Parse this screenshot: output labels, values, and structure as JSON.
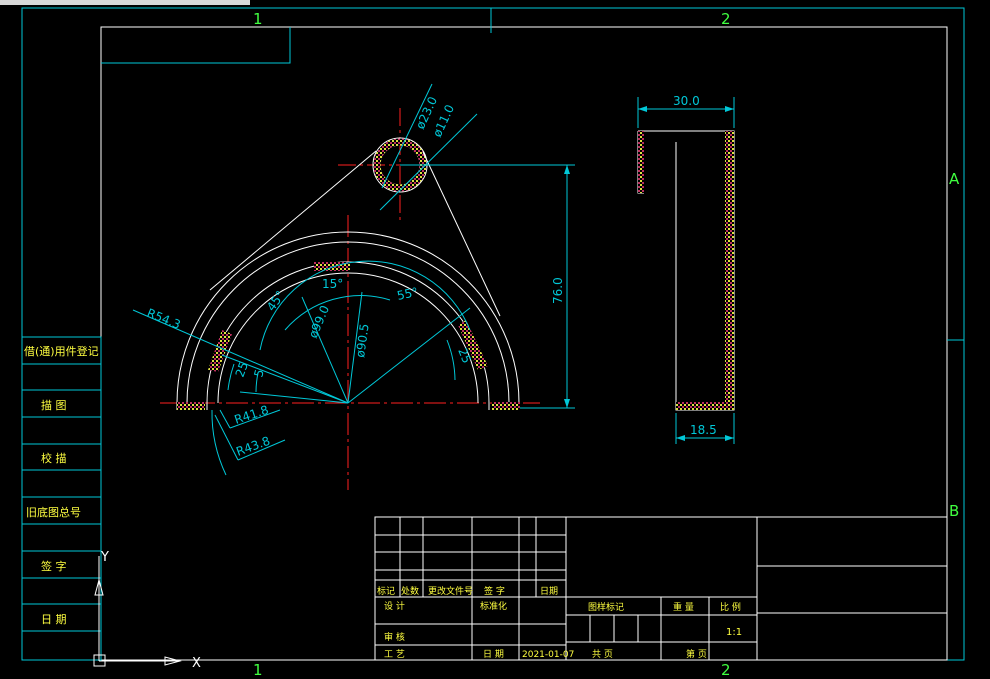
{
  "zone_marks": {
    "top_1": "1",
    "top_2": "2",
    "bottom_1": "1",
    "bottom_2": "2",
    "right_a": "A",
    "right_b": "B"
  },
  "left_strip": {
    "items": [
      "借(通)用件登记",
      "描  图",
      "校  描",
      "旧底图总号",
      "签  字",
      "日  期"
    ]
  },
  "dimensions": {
    "d23": "ø23.0",
    "d11": "ø11.0",
    "r54": "R54.3",
    "d99": "ø99.0",
    "d90": "ø90.5",
    "a45": "45°",
    "a15": "15°",
    "a55": "55°",
    "a25_left": "25",
    "a25_right": "25",
    "a5": "5",
    "r41": "R41.8",
    "r43": "R43.8",
    "h76": "76.0",
    "w30": "30.0",
    "w18": "18.5"
  },
  "title_block": {
    "row_labels": [
      "标记",
      "处数",
      "更改文件号",
      "签  字",
      "日期"
    ],
    "design": "设  计",
    "standard": "标准化",
    "review": "审  核",
    "process": "工  艺",
    "date_label": "日  期",
    "date_value": "2021-01-07",
    "drawing_mark": "图样标记",
    "weight": "重  量",
    "scale_label": "比  例",
    "scale_value": "1:1",
    "total": "共    页",
    "page": "第    页"
  },
  "ucs": {
    "y_label": "Y",
    "x_label": "X"
  }
}
